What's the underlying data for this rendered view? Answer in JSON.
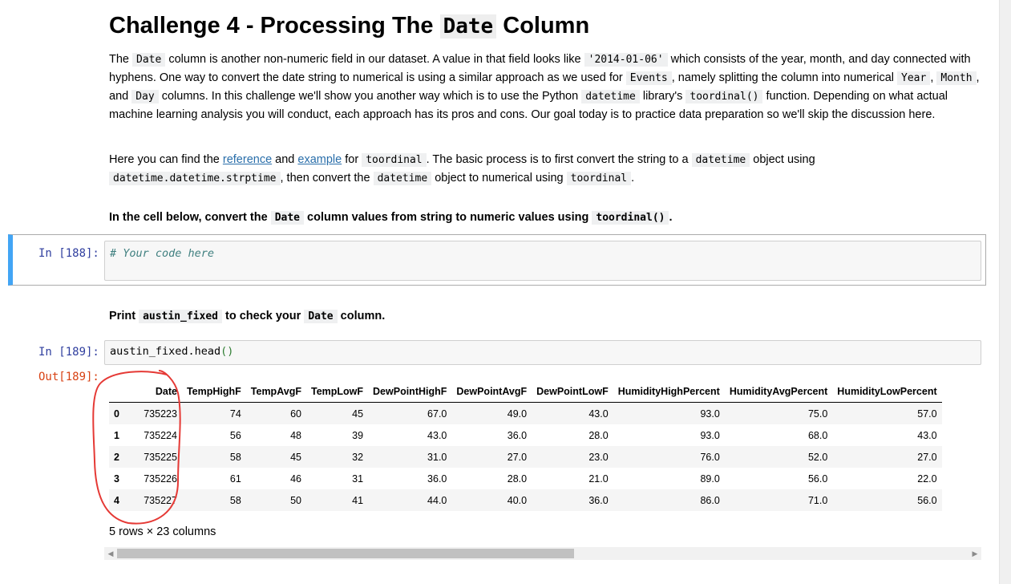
{
  "heading": {
    "prefix": "Challenge 4 - Processing The ",
    "code": "Date",
    "suffix": " Column"
  },
  "para1": {
    "t1": "The ",
    "c1": "Date",
    "t2": " column is another non-numeric field in our dataset. A value in that field looks like ",
    "c2": "'2014-01-06'",
    "t3": " which consists of the year, month, and day connected with hyphens. One way to convert the date string to numerical is using a similar approach as we used for ",
    "c3": "Events",
    "t4": ", namely splitting the column into numerical ",
    "c4": "Year",
    "t5": ", ",
    "c5": "Month",
    "t6": ", and ",
    "c6": "Day",
    "t7": " columns. In this challenge we'll show you another way which is to use the Python ",
    "c7": "datetime",
    "t8": " library's ",
    "c8": "toordinal()",
    "t9": " function. Depending on what actual machine learning analysis you will conduct, each approach has its pros and cons. Our goal today is to practice data preparation so we'll skip the discussion here."
  },
  "para2": {
    "t1": "Here you can find the ",
    "link1": "reference",
    "t2": " and ",
    "link2": "example",
    "t3": " for ",
    "c1": "toordinal",
    "t4": ". The basic process is to first convert the string to a ",
    "c2": "datetime",
    "t5": " object using ",
    "c3": "datetime.datetime.strptime",
    "t6": ", then convert the ",
    "c4": "datetime",
    "t7": " object to numerical using ",
    "c5": "toordinal",
    "t8": "."
  },
  "instruction1": {
    "t1": "In the cell below, convert the ",
    "c1": "Date",
    "t2": " column values from string to numeric values using ",
    "c2": "toordinal()",
    "t3": "."
  },
  "cell188": {
    "prompt": "In [188]:",
    "code": "# Your code here"
  },
  "instruction2": {
    "t1": "Print ",
    "c1": "austin_fixed",
    "t2": " to check your ",
    "c2": "Date",
    "t3": " column."
  },
  "cell189": {
    "prompt": "In [189]:",
    "code_obj": "austin_fixed.head",
    "code_paren": "()",
    "out_prompt": "Out[189]:"
  },
  "table": {
    "columns": [
      "",
      "Date",
      "TempHighF",
      "TempAvgF",
      "TempLowF",
      "DewPointHighF",
      "DewPointAvgF",
      "DewPointLowF",
      "HumidityHighPercent",
      "HumidityAvgPercent",
      "HumidityLowPercent"
    ],
    "rows": [
      [
        "0",
        "735223",
        "74",
        "60",
        "45",
        "67.0",
        "49.0",
        "43.0",
        "93.0",
        "75.0",
        "57.0"
      ],
      [
        "1",
        "735224",
        "56",
        "48",
        "39",
        "43.0",
        "36.0",
        "28.0",
        "93.0",
        "68.0",
        "43.0"
      ],
      [
        "2",
        "735225",
        "58",
        "45",
        "32",
        "31.0",
        "27.0",
        "23.0",
        "76.0",
        "52.0",
        "27.0"
      ],
      [
        "3",
        "735226",
        "61",
        "46",
        "31",
        "36.0",
        "28.0",
        "21.0",
        "89.0",
        "56.0",
        "22.0"
      ],
      [
        "4",
        "735227",
        "58",
        "50",
        "41",
        "44.0",
        "40.0",
        "36.0",
        "86.0",
        "71.0",
        "56.0"
      ]
    ],
    "summary": "5 rows × 23 columns"
  },
  "colors": {
    "accent": "#42a5f5",
    "in_prompt": "#303f9f",
    "out_prompt": "#d84315",
    "annotation": "#e53935"
  }
}
